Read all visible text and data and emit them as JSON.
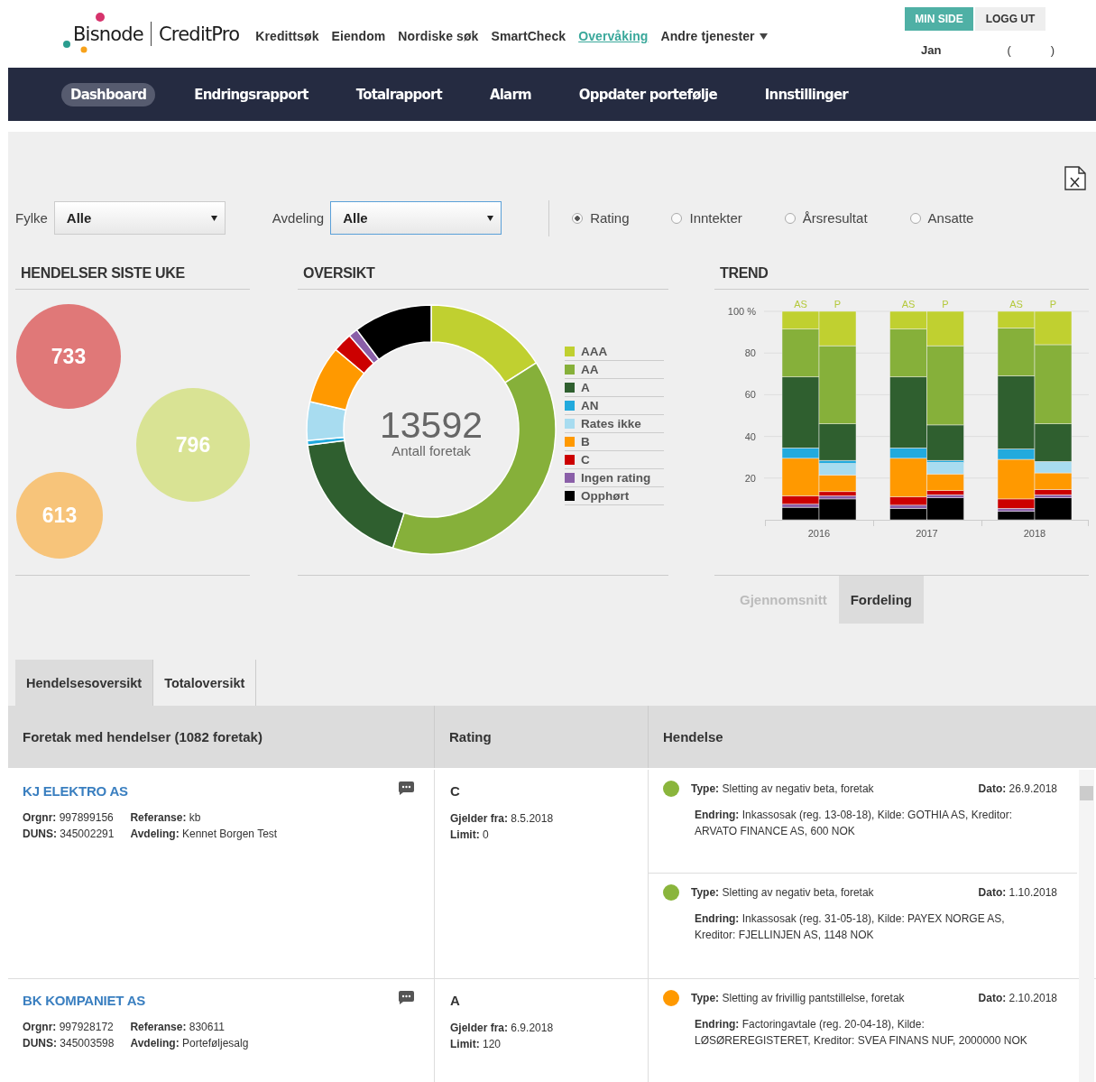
{
  "header": {
    "logo": {
      "brand": "Bisnode",
      "product": "CreditPro"
    },
    "nav": [
      {
        "label": "Kredittsøk",
        "selected": false,
        "kind": "link"
      },
      {
        "label": "Eiendom",
        "selected": false,
        "kind": "link"
      },
      {
        "label": "Nordiske søk",
        "selected": false,
        "kind": "link"
      },
      {
        "label": "SmartCheck",
        "selected": false,
        "kind": "link"
      },
      {
        "label": "Overvåking",
        "selected": true,
        "kind": "link"
      },
      {
        "label": "Andre tjenester",
        "selected": false,
        "kind": "dropdown"
      }
    ],
    "account_buttons": [
      {
        "label": "MIN SIDE",
        "kind": "primary"
      },
      {
        "label": "LOGG UT",
        "kind": "secondary"
      }
    ],
    "user": {
      "name": "Jan",
      "brackets": [
        "(",
        ")"
      ]
    }
  },
  "main_nav": [
    {
      "label": "Dashboard",
      "selected": true
    },
    {
      "label": "Endringsrapport",
      "selected": false
    },
    {
      "label": "Totalrapport",
      "selected": false
    },
    {
      "label": "Alarm",
      "selected": false
    },
    {
      "label": "Oppdater portefølje",
      "selected": false
    },
    {
      "label": "Innstillinger",
      "selected": false
    }
  ],
  "filters": {
    "selects": [
      {
        "label": "Fylke",
        "value": "Alle",
        "focused": false
      },
      {
        "label": "Avdeling",
        "value": "Alle",
        "focused": true
      }
    ],
    "radios": [
      {
        "label": "Rating",
        "selected": true
      },
      {
        "label": "Inntekter",
        "selected": false
      },
      {
        "label": "Årsresultat",
        "selected": false
      },
      {
        "label": "Ansatte",
        "selected": false
      }
    ]
  },
  "events_last_week": {
    "title": "HENDELSER SISTE UKE",
    "bubbles": [
      {
        "count": "733",
        "color": "#e07878"
      },
      {
        "count": "796",
        "color": "#d9e394"
      },
      {
        "count": "613",
        "color": "#f7c47a"
      }
    ]
  },
  "overview": {
    "title": "OVERSIKT",
    "total": "13592",
    "total_label": "Antall foretak",
    "legend": [
      {
        "label": "AAA",
        "color": "#c0d030"
      },
      {
        "label": "AA",
        "color": "#86b03a"
      },
      {
        "label": "A",
        "color": "#2f5f2f"
      },
      {
        "label": "AN",
        "color": "#22aadd"
      },
      {
        "label": "Rates ikke",
        "color": "#a8dcf0"
      },
      {
        "label": "B",
        "color": "#ff9900"
      },
      {
        "label": "C",
        "color": "#cc0000"
      },
      {
        "label": "Ingen rating",
        "color": "#8a5fa8"
      },
      {
        "label": "Opphørt",
        "color": "#000000"
      }
    ]
  },
  "trend": {
    "title": "TREND",
    "chart_data": {
      "type": "bar",
      "stacked": true,
      "categories": [
        "AS",
        "P",
        "AS",
        "P",
        "AS",
        "P"
      ],
      "grid": true,
      "ylim": [
        0,
        100
      ],
      "yticks": [
        20,
        40,
        60,
        80,
        {
          "value": 100,
          "label": "100 %"
        }
      ],
      "series": [
        {
          "color": "#c0d030",
          "values": [
            8.5,
            16.5,
            8.5,
            16.5,
            8,
            16
          ]
        },
        {
          "color": "#86b03a",
          "values": [
            23,
            37.5,
            23,
            38,
            23,
            38
          ]
        },
        {
          "color": "#2f5f2f",
          "values": [
            34,
            17.5,
            34,
            17,
            35,
            18
          ]
        },
        {
          "color": "#22aadd",
          "values": [
            5,
            1.5,
            5,
            1,
            5,
            0
          ]
        },
        {
          "color": "#a8dcf0",
          "values": [
            0,
            5.5,
            0,
            5.5,
            0,
            5.5
          ]
        },
        {
          "color": "#ff9900",
          "values": [
            18,
            8,
            18.5,
            8,
            19,
            8
          ]
        },
        {
          "color": "#cc0000",
          "values": [
            4,
            2,
            4,
            2,
            4.5,
            2.5
          ]
        },
        {
          "color": "#8a5fa8",
          "values": [
            1.5,
            1.5,
            1.5,
            1.5,
            1.5,
            1.5
          ]
        },
        {
          "color": "#000000",
          "values": [
            6,
            10,
            5.5,
            10.5,
            4,
            10.5
          ]
        }
      ]
    },
    "year_groups": [
      "2016",
      "2017",
      "2018"
    ],
    "view_tabs": [
      {
        "label": "Gjennomsnitt",
        "selected": false
      },
      {
        "label": "Fordeling",
        "selected": true
      }
    ]
  },
  "tabs": [
    {
      "label": "Hendelsesoversikt",
      "selected": true
    },
    {
      "label": "Totaloversikt",
      "selected": false
    }
  ],
  "table": {
    "columns": [
      "Foretak med hendelser (1082 foretak)",
      "Rating",
      "Hendelse"
    ],
    "rows": [
      {
        "company": "KJ ELEKTRO AS",
        "details": [
          "**Orgnr:** 997899156",
          "**Referanse:** kb",
          "**DUNS:** 345002291",
          "**Avdeling:** Kennet Borgen Test"
        ],
        "rating": "C",
        "rating_details": [
          "**Gjelder fra:** 8.5.2018",
          "**Limit:** 0"
        ],
        "events": [
          {
            "color": "#8ab53c",
            "type": "**Type:** Sletting av negativ beta, foretak",
            "date": "**Dato:** 26.9.2018",
            "change": "**Endring:** Inkassosak (reg. 13-08-18), Kilde: GOTHIA AS, Kreditor: ARVATO FINANCE AS, 600 NOK"
          },
          {
            "color": "#8ab53c",
            "type": "**Type:** Sletting av negativ beta, foretak",
            "date": "**Dato:** 1.10.2018",
            "change": "**Endring:** Inkassosak (reg. 31-05-18), Kilde: PAYEX NORGE AS, Kreditor: FJELLINJEN AS, 1148 NOK"
          }
        ]
      },
      {
        "company": "BK KOMPANIET AS",
        "details": [
          "**Orgnr:** 997928172",
          "**Referanse:** 830611",
          "**DUNS:** 345003598",
          "**Avdeling:** Porteføljesalg"
        ],
        "rating": "A",
        "rating_details": [
          "**Gjelder fra:** 6.9.2018",
          "**Limit:** 120"
        ],
        "events": [
          {
            "color": "#ff9900",
            "type": "**Type:** Sletting av frivillig pantstillelse, foretak",
            "date": "**Dato:** 2.10.2018",
            "change": "**Endring:** Factoringavtale (reg. 20-04-18), Kilde: LØSØREREGISTERET, Kreditor: SVEA FINANS NUF, 2000000 NOK"
          }
        ]
      }
    ]
  }
}
